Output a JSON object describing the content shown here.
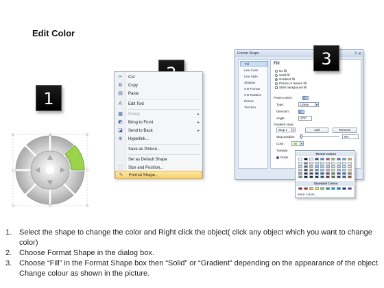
{
  "title": "Edit Color",
  "badges": [
    "1",
    "2",
    "3"
  ],
  "context_menu": {
    "items": [
      {
        "icon": "cut-icon",
        "glyph": "✂",
        "label": "Cut",
        "arrow": false,
        "disabled": false
      },
      {
        "icon": "copy-icon",
        "glyph": "⧉",
        "label": "Copy",
        "arrow": false,
        "disabled": false
      },
      {
        "icon": "paste-icon",
        "glyph": "▤",
        "label": "Paste",
        "arrow": false,
        "disabled": false
      },
      {
        "icon": "edit-text-icon",
        "glyph": "A",
        "label": "Edit Text",
        "arrow": false,
        "disabled": false
      },
      {
        "icon": "group-icon",
        "glyph": "▦",
        "label": "Group",
        "arrow": true,
        "disabled": true
      },
      {
        "icon": "bring-to-front-icon",
        "glyph": "◩",
        "label": "Bring to Front",
        "arrow": true,
        "disabled": false
      },
      {
        "icon": "send-to-back-icon",
        "glyph": "◪",
        "label": "Send to Back",
        "arrow": true,
        "disabled": false
      },
      {
        "icon": "hyperlink-icon",
        "glyph": "⊕",
        "label": "Hyperlink...",
        "arrow": false,
        "disabled": false
      },
      {
        "icon": "",
        "glyph": "",
        "label": "Save as Picture...",
        "arrow": false,
        "disabled": false
      },
      {
        "icon": "",
        "glyph": "",
        "label": "Set as Default Shape",
        "arrow": false,
        "disabled": false
      },
      {
        "icon": "size-position-icon",
        "glyph": "⬚",
        "label": "Size and Position...",
        "arrow": false,
        "disabled": false
      },
      {
        "icon": "format-shape-icon",
        "glyph": "✎",
        "label": "Format Shape...",
        "arrow": false,
        "disabled": false
      }
    ]
  },
  "dialog": {
    "title": "Format Shape",
    "nav": [
      "Fill",
      "Line Color",
      "Line Style",
      "Shadow",
      "3-D Format",
      "3-D Rotation",
      "Picture",
      "Text Box"
    ],
    "fill_heading": "Fill",
    "options": [
      "No fill",
      "Solid fill",
      "Gradient fill",
      "Picture or texture fill",
      "Slide background fill"
    ],
    "preset_label": "Preset colors:",
    "type_label": "Type:",
    "type_value": "Linear",
    "direction_label": "Direction:",
    "angle_label": "Angle:",
    "angle_value": "270°",
    "stops_label": "Gradient stops",
    "stop_value": "Stop 1",
    "add_label": "Add",
    "remove_label": "Remove",
    "stop_pos_label": "Stop position:",
    "stop_pos_value": "0%",
    "color_label": "Color:",
    "transp_label": "Transpa",
    "rotate_label": "Rotat"
  },
  "palette": {
    "theme_heading": "Theme Colors",
    "standard_heading": "Standard Colors",
    "more": "More Colors...",
    "theme_top": [
      "#ffffff",
      "#000000",
      "#eeece1",
      "#1f497d",
      "#4f81bd",
      "#c0504d",
      "#9bbb59",
      "#8064a2",
      "#4bacc6",
      "#f79646"
    ],
    "theme_rows": [
      [
        "#f2f2f2",
        "#7f7f7f",
        "#ddd9c3",
        "#c6d9f0",
        "#dbe5f1",
        "#f2dcdb",
        "#ebf1dd",
        "#e5e0ec",
        "#dbeef3",
        "#fdeada"
      ],
      [
        "#d8d8d8",
        "#595959",
        "#c4bd97",
        "#8db3e2",
        "#b8cce4",
        "#e5b9b7",
        "#d7e3bc",
        "#ccc1d9",
        "#b7dde8",
        "#fbd5b5"
      ],
      [
        "#bfbfbf",
        "#3f3f3f",
        "#938953",
        "#548dd4",
        "#95b3d7",
        "#d99694",
        "#c3d69b",
        "#b2a2c7",
        "#92cddc",
        "#fac08f"
      ],
      [
        "#a5a5a5",
        "#262626",
        "#494429",
        "#17365d",
        "#366092",
        "#953734",
        "#76923c",
        "#5f497a",
        "#31859b",
        "#e36c09"
      ],
      [
        "#7f7f7f",
        "#0c0c0c",
        "#1d1b10",
        "#0f243e",
        "#244061",
        "#632423",
        "#4f6128",
        "#3f3151",
        "#205867",
        "#974806"
      ]
    ],
    "standard": [
      "#c00000",
      "#ff0000",
      "#ffc000",
      "#ffff00",
      "#92d050",
      "#00b050",
      "#00b0f0",
      "#0070c0",
      "#002060",
      "#7030a0"
    ]
  },
  "steps": [
    {
      "num": "1.",
      "text": "Select the shape to change the color and Right click the object( click any object which you want to change color)"
    },
    {
      "num": "2.",
      "text": "Choose Format Shape in the dialog box."
    },
    {
      "num": "3.",
      "text": "Choose “Fill” in the Format Shape box then “Solid” or “Gradient” depending on the appearance of the object. Change colour as shown in the picture."
    }
  ],
  "colors": {
    "accent_green": "#9bd34a",
    "ring_gray": "#c9c9c9",
    "menu_highlight": "#f8cf6a"
  }
}
